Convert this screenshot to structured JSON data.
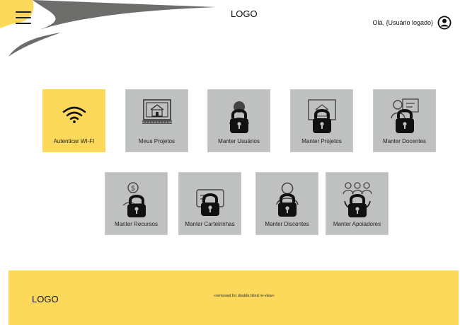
{
  "header": {
    "logo": "LOGO",
    "user_greeting": "Olá, {Usuário logado}",
    "menu_icon": "hamburger-menu-icon",
    "avatar_icon": "user-circle-icon"
  },
  "tiles_row1": [
    {
      "label": "Autenticar WI-FI",
      "icon": "wifi-icon",
      "active": true
    },
    {
      "label": "Meus Projetos",
      "icon": "blueprint-icon",
      "active": false
    },
    {
      "label": "Manter Usuários",
      "icon": "lock-icon",
      "active": false
    },
    {
      "label": "Manter Projetos",
      "icon": "lock-icon",
      "active": false
    },
    {
      "label": "Manter Docentes",
      "icon": "lock-icon",
      "active": false
    }
  ],
  "tiles_row2": [
    {
      "label": "Manter Recursos",
      "icon": "lock-icon",
      "active": false
    },
    {
      "label": "Manter Carteirinhas",
      "icon": "lock-icon",
      "active": false
    },
    {
      "label": "Manter Discentes",
      "icon": "lock-icon",
      "active": false
    },
    {
      "label": "Manter Apoiadores",
      "icon": "lock-icon",
      "active": false
    }
  ],
  "footer": {
    "logo": "LOGO",
    "note": "«removed for double blind re-view»"
  },
  "colors": {
    "accent_yellow": "#fcd95a",
    "tile_gray": "#bfc1c0",
    "swoosh_gray": "#6d6e6c"
  }
}
